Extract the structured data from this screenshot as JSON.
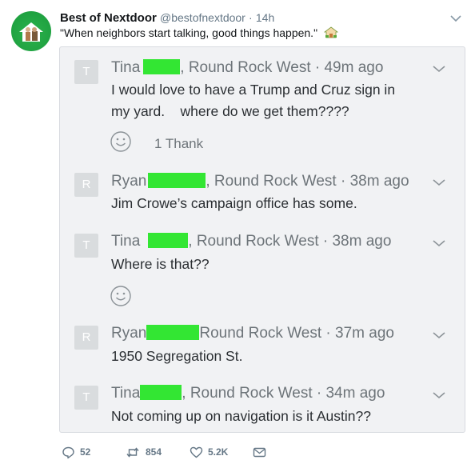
{
  "tweet": {
    "display_name": "Best of Nextdoor",
    "handle": "@bestofnextdoor",
    "separator": "·",
    "time": "14h",
    "text": "\"When neighbors start talking, good things happen.\""
  },
  "comments": [
    {
      "initial": "T",
      "author": "Tina",
      "location": ", Round Rock West",
      "separator": " · ",
      "time": "49m ago",
      "lines": [
        "I would love to have a Trump and Cruz sign in",
        "my yard.    where do we get them????"
      ]
    },
    {
      "initial": "R",
      "author": "Ryan",
      "location": ", Round Rock West",
      "separator": " · ",
      "time": "38m ago",
      "lines": [
        "Jim Crowe’s campaign office has some."
      ]
    },
    {
      "initial": "T",
      "author": "Tina",
      "location": ", Round Rock West",
      "separator": " · ",
      "time": "38m ago",
      "lines": [
        "Where is that??"
      ]
    },
    {
      "initial": "R",
      "author": "Ryan",
      "location": "Round Rock West",
      "separator": " · ",
      "time": "37m ago",
      "lines": [
        "1950 Segregation St."
      ]
    },
    {
      "initial": "T",
      "author": "Tina",
      "location": ", Round Rock West",
      "separator": " · ",
      "time": "34m ago",
      "lines": [
        "Not coming up on navigation is it Austin??"
      ]
    }
  ],
  "thanks": {
    "count_label": "1 Thank"
  },
  "actions": {
    "replies": "52",
    "retweets": "854",
    "likes": "5.2K"
  },
  "colors": {
    "redaction": "#33e633",
    "avatar_bg": "#2bb24c",
    "card_bg": "#f1f2f4"
  },
  "icons": [
    "house-icon",
    "house-emoji-icon",
    "chevron-down-icon",
    "smiley-icon",
    "reply-icon",
    "retweet-icon",
    "heart-icon",
    "mail-icon"
  ]
}
